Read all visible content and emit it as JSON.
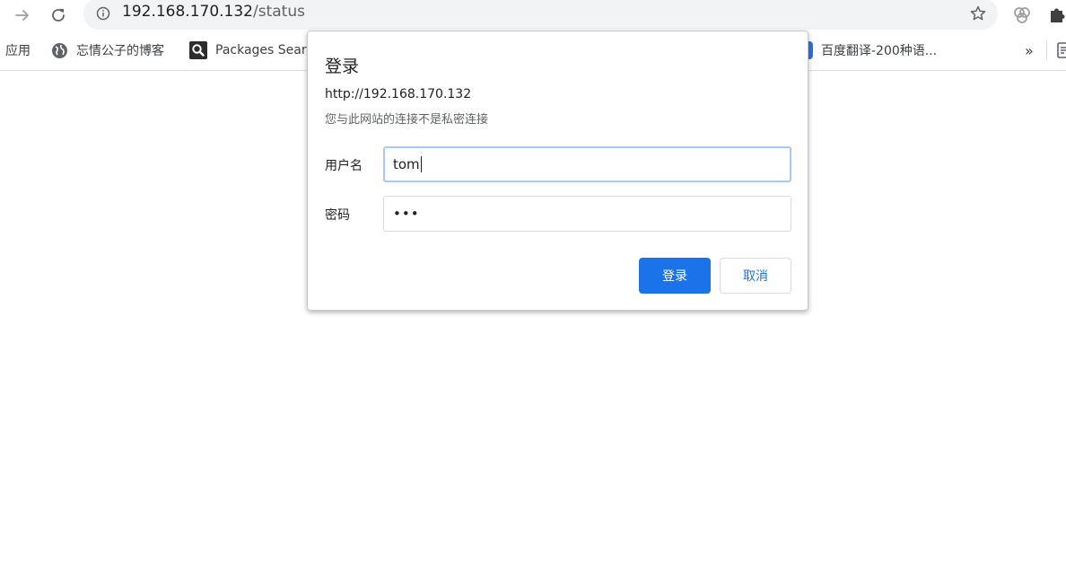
{
  "browser": {
    "url_host": "192.168.170.132",
    "url_path": "/status"
  },
  "bookmarks": {
    "apps_label": "应用",
    "items": [
      {
        "label": "忘情公子的博客",
        "icon": "globe-icon"
      },
      {
        "label": "Packages Sear",
        "icon": "search-icon"
      },
      {
        "label": "百度翻译-200种语...",
        "icon": "translate-icon"
      }
    ],
    "overflow_label": "»"
  },
  "dialog": {
    "title": "登录",
    "origin": "http://192.168.170.132",
    "note": "您与此网站的连接不是私密连接",
    "username_label": "用户名",
    "username_value": "tom",
    "password_label": "密码",
    "password_value": "•••",
    "login_button": "登录",
    "cancel_button": "取消"
  },
  "colors": {
    "primary": "#1a73e8",
    "omnibox_bg": "#f1f3f4",
    "focus_ring": "#a8c7fa"
  }
}
